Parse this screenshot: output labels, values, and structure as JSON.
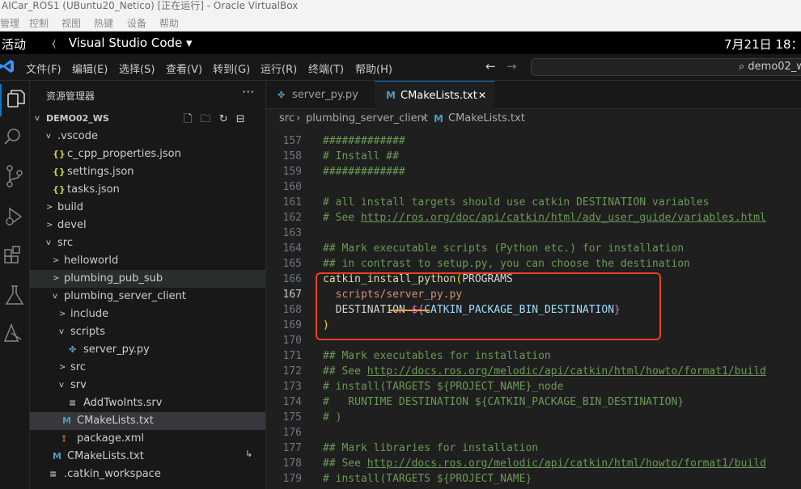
{
  "vbox": {
    "title": "AICar_ROS1 (UBuntu20_Netico) [正在运行] - Oracle VirtualBox",
    "menu": [
      "管理",
      "控制",
      "视图",
      "热键",
      "设备",
      "帮助"
    ]
  },
  "gnome": {
    "activities": "活动",
    "app": "Visual Studio Code ▾",
    "clock": "7月21日  18：4"
  },
  "menubar": {
    "items": [
      "文件(F)",
      "编辑(E)",
      "选择(S)",
      "查看(V)",
      "转到(G)",
      "运行(R)",
      "终端(T)",
      "帮助(H)"
    ],
    "search": "demo02_w"
  },
  "explorer": {
    "title": "资源管理器",
    "more": "···",
    "workspace": "DEMO02_WS",
    "tree": [
      {
        "label": ".vscode",
        "chev": "v",
        "icon": "",
        "icon_type": ""
      },
      {
        "label": "c_cpp_properties.json",
        "chev": "",
        "icon": "{}",
        "icon_type": "json"
      },
      {
        "label": "settings.json",
        "chev": "",
        "icon": "{}",
        "icon_type": "json"
      },
      {
        "label": "tasks.json",
        "chev": "",
        "icon": "{}",
        "icon_type": "json"
      },
      {
        "label": "build",
        "chev": ">",
        "icon": "",
        "icon_type": ""
      },
      {
        "label": "devel",
        "chev": ">",
        "icon": "",
        "icon_type": ""
      },
      {
        "label": "src",
        "chev": "v",
        "icon": "",
        "icon_type": ""
      },
      {
        "label": "helloworld",
        "chev": ">",
        "icon": "",
        "icon_type": ""
      },
      {
        "label": "plumbing_pub_sub",
        "chev": ">",
        "icon": "",
        "icon_type": ""
      },
      {
        "label": "plumbing_server_client",
        "chev": "v",
        "icon": "",
        "icon_type": ""
      },
      {
        "label": "include",
        "chev": ">",
        "icon": "",
        "icon_type": ""
      },
      {
        "label": "scripts",
        "chev": "v",
        "icon": "",
        "icon_type": ""
      },
      {
        "label": "server_py.py",
        "chev": "",
        "icon": "✤",
        "icon_type": "py"
      },
      {
        "label": "src",
        "chev": ">",
        "icon": "",
        "icon_type": ""
      },
      {
        "label": "srv",
        "chev": "v",
        "icon": "",
        "icon_type": ""
      },
      {
        "label": "AddTwoInts.srv",
        "chev": "",
        "icon": "≡",
        "icon_type": "srv"
      },
      {
        "label": "CMakeLists.txt",
        "chev": "",
        "icon": "M",
        "icon_type": "cm"
      },
      {
        "label": "package.xml",
        "chev": "",
        "icon": "⟟",
        "icon_type": "xml"
      },
      {
        "label": "CMakeLists.txt",
        "chev": "",
        "icon": "M",
        "icon_type": "cm"
      },
      {
        "label": ".catkin_workspace",
        "chev": "",
        "icon": "≡",
        "icon_type": "srv"
      }
    ],
    "link_marker": "↳"
  },
  "tabs": [
    {
      "label": "server_py.py",
      "active": false
    },
    {
      "label": "CMakeLists.txt",
      "active": true,
      "close": "✕"
    }
  ],
  "breadcrumb": [
    "src",
    "plumbing_server_client",
    "CMakeLists.txt"
  ],
  "editor": {
    "line_numbers": [
      "157",
      "158",
      "159",
      "160",
      "161",
      "162",
      "163",
      "164",
      "165",
      "166",
      "167",
      "168",
      "169",
      "170",
      "171",
      "172",
      "173",
      "174",
      "175",
      "176",
      "177",
      "178",
      "179"
    ],
    "current_line": "167",
    "lines": {
      "l157": "#############",
      "l158": "# Install ##",
      "l159": "#############",
      "l160": "",
      "l161": "# all install targets should use catkin DESTINATION variables",
      "l162a": "# See ",
      "l162b": "http://ros.org/doc/api/catkin/html/adv_user_guide/variables.html",
      "l163": "",
      "l164": "## Mark executable scripts (Python etc.) for installation",
      "l165": "## in contrast to setup.py, you can choose the destination",
      "l166a": "catkin_install_python",
      "l166b": "(",
      "l166c": "PROGRAMS",
      "l167": "  scripts/server_py.py",
      "l168a": "  DESTINATION ",
      "l168b": "${",
      "l168c": "CATKIN_PACKAGE_BIN_DESTINATION",
      "l168d": "}",
      "l169": ")",
      "l170": "",
      "l171": "## Mark executables for installation",
      "l172a": "## See ",
      "l172b": "http://docs.ros.org/melodic/api/catkin/html/howto/format1/build",
      "l173": "# install(TARGETS ${PROJECT_NAME}_node",
      "l174": "#   RUNTIME DESTINATION ${CATKIN_PACKAGE_BIN_DESTINATION}",
      "l175": "# )",
      "l176": "",
      "l177": "## Mark libraries for installation",
      "l178a": "## See ",
      "l178b": "http://docs.ros.org/melodic/api/catkin/html/howto/format1/build",
      "l179": "# install(TARGETS ${PROJECT_NAME}"
    }
  },
  "colors": {
    "accent": "#0078d4",
    "highlight_box": "#e8431f",
    "comment": "#6a9955"
  }
}
